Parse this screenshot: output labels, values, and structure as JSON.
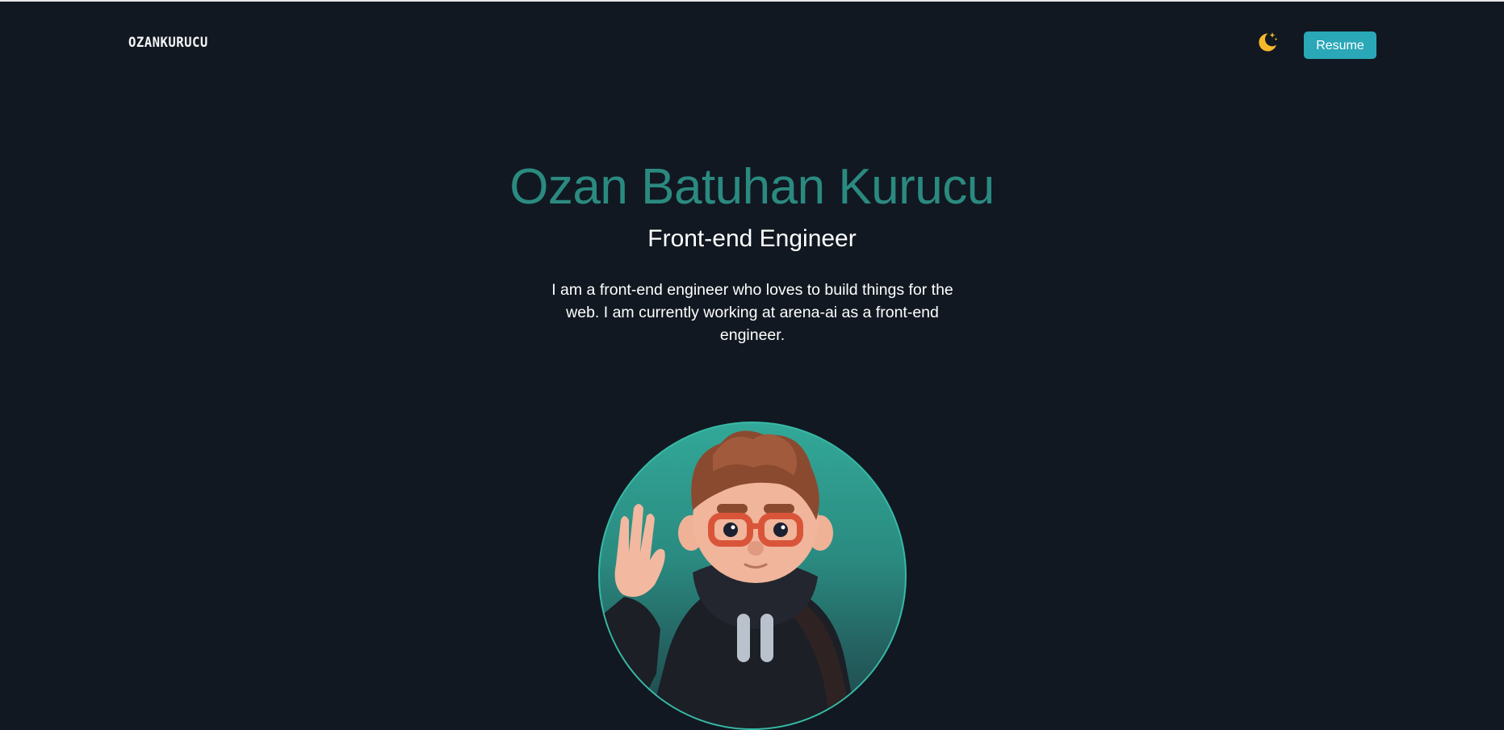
{
  "header": {
    "logo": "OZANKURUCU",
    "theme_toggle_icon": "moon-stars-icon",
    "resume_label": "Resume"
  },
  "hero": {
    "name": "Ozan Batuhan Kurucu",
    "role": "Front-end Engineer",
    "bio": "I am a front-end engineer who loves to build things for the web. I am currently working at arena-ai as a front-end engineer."
  },
  "colors": {
    "background": "#111821",
    "accent": "#2b8a80",
    "button": "#2aa8b8",
    "moon": "#f5b82a"
  }
}
